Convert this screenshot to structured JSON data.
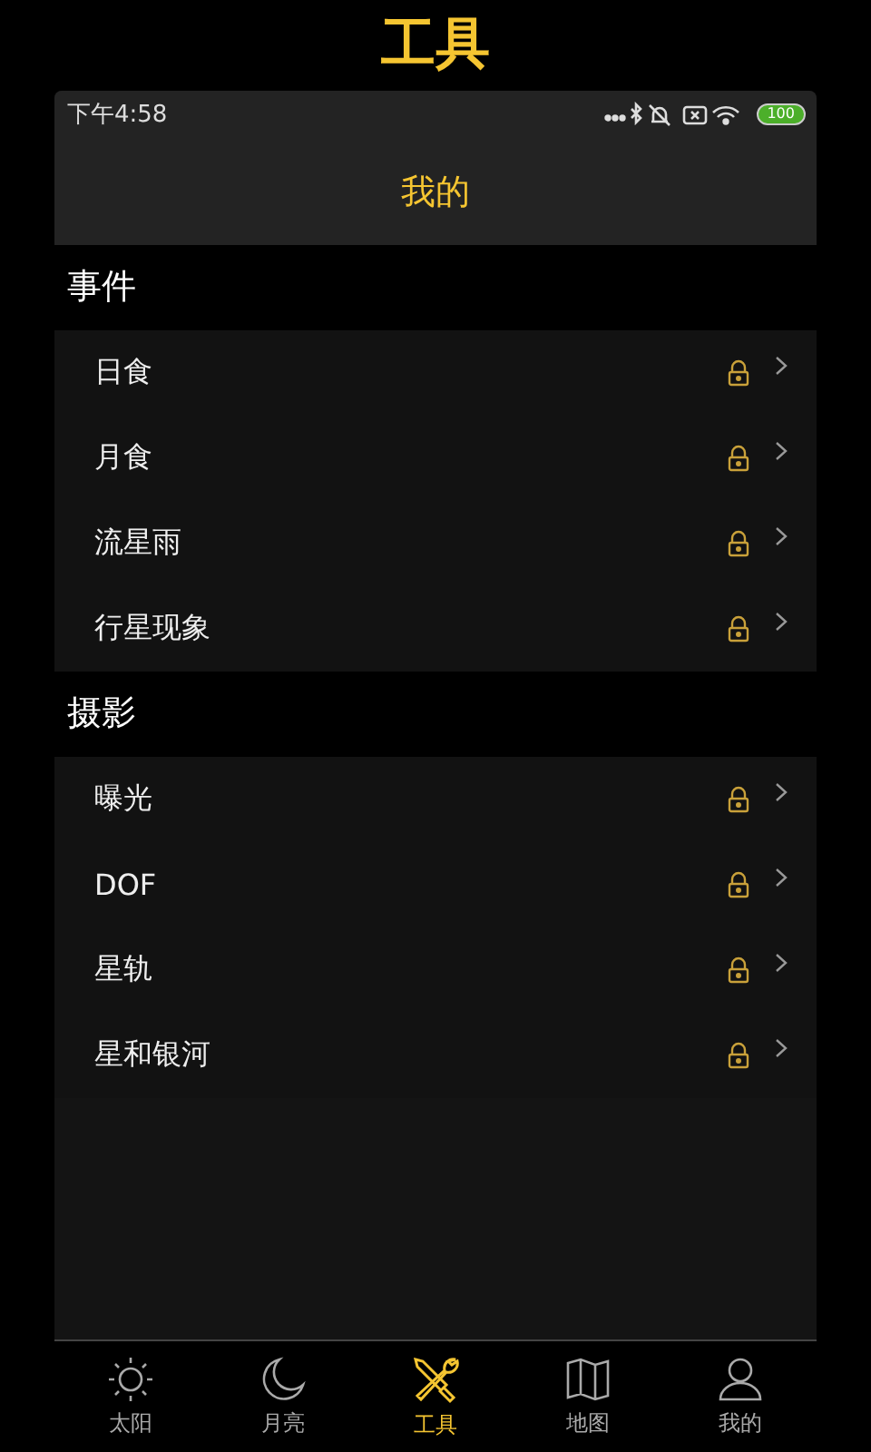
{
  "page_title": "工具",
  "status_bar": {
    "time": "下午4:58",
    "battery": "100"
  },
  "header": {
    "title": "我的"
  },
  "sections": [
    {
      "title": "事件",
      "items": [
        {
          "label": "日食",
          "locked": true
        },
        {
          "label": "月食",
          "locked": true
        },
        {
          "label": "流星雨",
          "locked": true
        },
        {
          "label": "行星现象",
          "locked": true
        }
      ]
    },
    {
      "title": "摄影",
      "items": [
        {
          "label": "曝光",
          "locked": true
        },
        {
          "label": "DOF",
          "locked": true
        },
        {
          "label": "星轨",
          "locked": true
        },
        {
          "label": "星和银河",
          "locked": true
        }
      ]
    }
  ],
  "tab_bar": [
    {
      "kind": "sun",
      "label": "太阳",
      "selected": false
    },
    {
      "kind": "moon",
      "label": "月亮",
      "selected": false
    },
    {
      "kind": "tools",
      "label": "工具",
      "selected": true
    },
    {
      "kind": "map",
      "label": "地图",
      "selected": false
    },
    {
      "kind": "person",
      "label": "我的",
      "selected": false
    }
  ]
}
